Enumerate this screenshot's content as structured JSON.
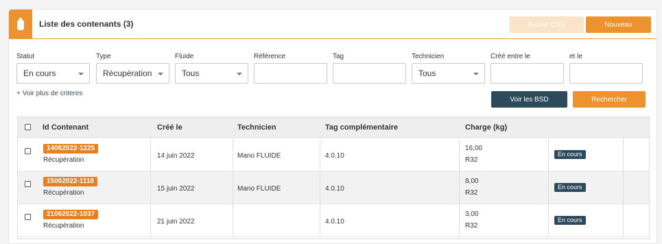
{
  "header": {
    "title": "Liste des contenants (3)",
    "icon": "gas-cylinder-icon",
    "export_label": "Export CSV",
    "new_label": "Nouveau"
  },
  "filters": {
    "statut": {
      "label": "Statut",
      "value": "En cours"
    },
    "type": {
      "label": "Type",
      "value": "Récupération"
    },
    "fluide": {
      "label": "Fluide",
      "value": "Tous"
    },
    "reference": {
      "label": "Référence",
      "value": ""
    },
    "tag": {
      "label": "Tag",
      "value": ""
    },
    "technicien": {
      "label": "Technicien",
      "value": "Tous"
    },
    "cree_entre": {
      "label": "Créé entre le",
      "value": ""
    },
    "et_le": {
      "label": "et le",
      "value": ""
    },
    "more_link": "+ Voir plus de criteres",
    "bsd_label": "Voir les BSD",
    "search_label": "Rechercher"
  },
  "table": {
    "columns": [
      "Id Contenant",
      "Créé le",
      "Technicien",
      "Tag complémentaire",
      "Charge (kg)"
    ],
    "rows": [
      {
        "id": "14062022-1225",
        "type": "Récupération",
        "date": "14 juin 2022",
        "tech": "Mano FLUIDE",
        "tag": "4.0.10",
        "charge": "16,00",
        "fluid": "R32",
        "status": "En cours"
      },
      {
        "id": "15062022-1118",
        "type": "Récupération",
        "date": "15 juin 2022",
        "tech": "Mano FLUIDE",
        "tag": "4.0.10",
        "charge": "8,00",
        "fluid": "R32",
        "status": "En cours"
      },
      {
        "id": "21062022-1037",
        "type": "Récupération",
        "date": "21 juin 2022",
        "tech": "",
        "tag": "4.0.10",
        "charge": "3,00",
        "fluid": "R32",
        "status": "En cours"
      }
    ]
  },
  "colors": {
    "accent": "#ec922e",
    "dark": "#2c4a5c"
  }
}
